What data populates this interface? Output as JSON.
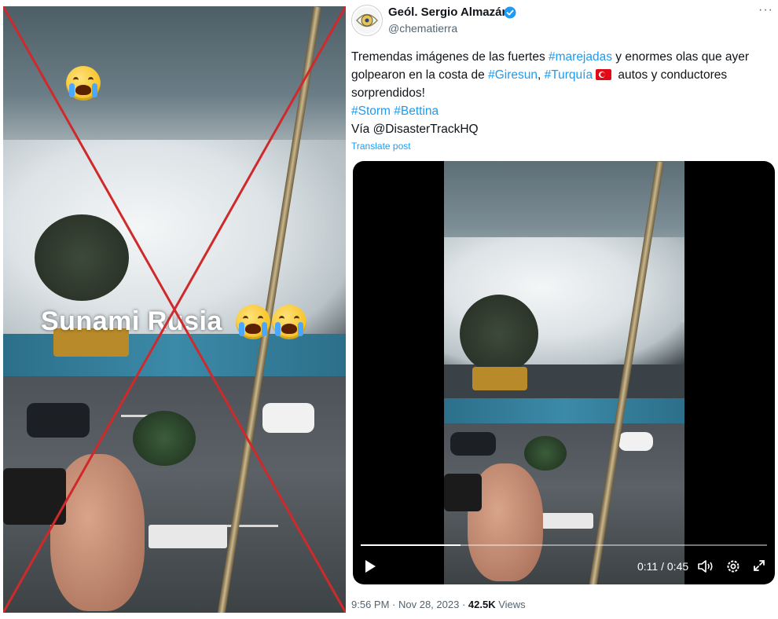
{
  "left_image": {
    "caption": "Sunami Rusia"
  },
  "tweet": {
    "author": {
      "display_name": "Geól. Sergio Almazán",
      "handle": "@chematierra",
      "verified": true
    },
    "more_icon": "more-horizontal-icon",
    "text": {
      "line1_a": "Tremendas imágenes de las fuertes ",
      "tag_marejadas": "#marejadas",
      "line1_b": " y enormes olas que ayer",
      "line2_a": "golpearon en la costa de ",
      "tag_giresun": "#Giresun",
      "comma": ", ",
      "tag_turquia": "#Turquía",
      "line2_b": " autos y conductores",
      "line3": "sorprendidos!",
      "tag_storm": "#Storm",
      "tag_bettina": "#Bettina",
      "via": "Vía @DisasterTrackHQ"
    },
    "translate_label": "Translate post",
    "video": {
      "current_time": "0:11",
      "separator": " / ",
      "duration": "0:45",
      "progress_fraction": 0.245,
      "controls": [
        "play-icon",
        "volume-icon",
        "settings-icon",
        "fullscreen-icon"
      ]
    },
    "meta": {
      "time": "9:56 PM",
      "dot1": " · ",
      "date": "Nov 28, 2023",
      "dot2": " · ",
      "views_count": "42.5K",
      "views_label": " Views"
    }
  },
  "colors": {
    "link": "#1d9bf0",
    "cross": "#d0292b",
    "verified": "#1d9bf0"
  }
}
